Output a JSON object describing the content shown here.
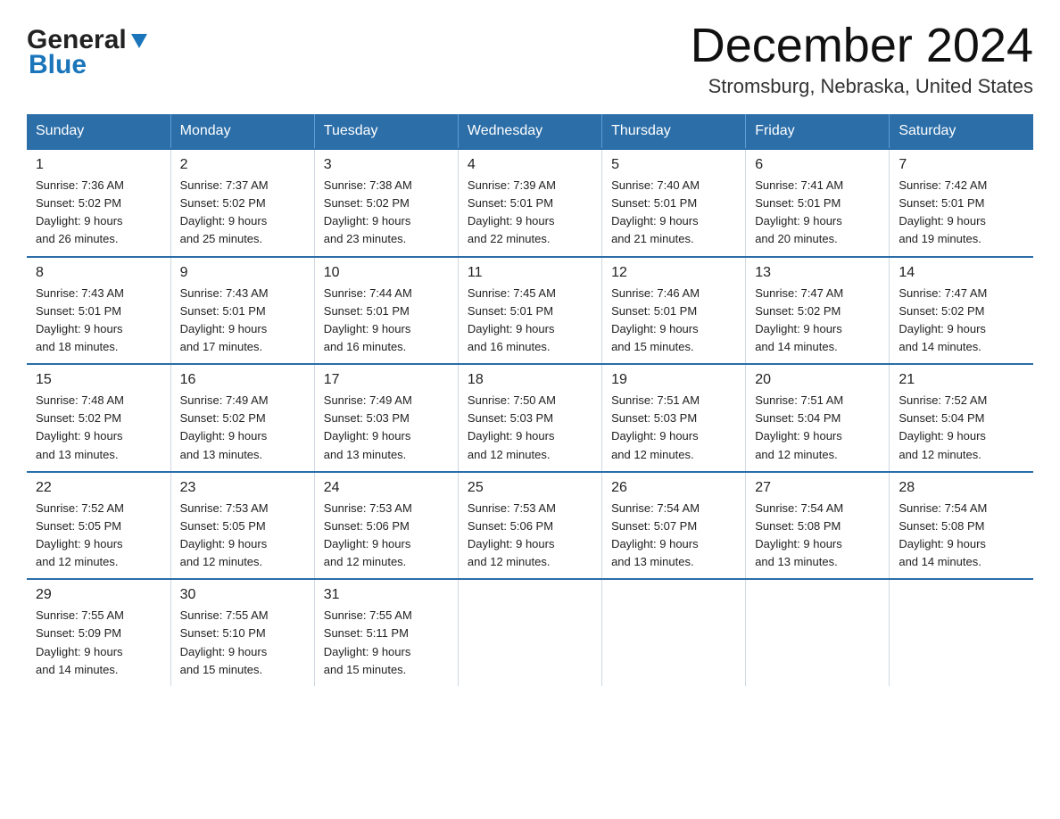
{
  "header": {
    "logo_general": "General",
    "logo_blue": "Blue",
    "month_title": "December 2024",
    "location": "Stromsburg, Nebraska, United States"
  },
  "calendar": {
    "days_of_week": [
      "Sunday",
      "Monday",
      "Tuesday",
      "Wednesday",
      "Thursday",
      "Friday",
      "Saturday"
    ],
    "weeks": [
      [
        {
          "date": "1",
          "sunrise": "7:36 AM",
          "sunset": "5:02 PM",
          "daylight": "9 hours and 26 minutes."
        },
        {
          "date": "2",
          "sunrise": "7:37 AM",
          "sunset": "5:02 PM",
          "daylight": "9 hours and 25 minutes."
        },
        {
          "date": "3",
          "sunrise": "7:38 AM",
          "sunset": "5:02 PM",
          "daylight": "9 hours and 23 minutes."
        },
        {
          "date": "4",
          "sunrise": "7:39 AM",
          "sunset": "5:01 PM",
          "daylight": "9 hours and 22 minutes."
        },
        {
          "date": "5",
          "sunrise": "7:40 AM",
          "sunset": "5:01 PM",
          "daylight": "9 hours and 21 minutes."
        },
        {
          "date": "6",
          "sunrise": "7:41 AM",
          "sunset": "5:01 PM",
          "daylight": "9 hours and 20 minutes."
        },
        {
          "date": "7",
          "sunrise": "7:42 AM",
          "sunset": "5:01 PM",
          "daylight": "9 hours and 19 minutes."
        }
      ],
      [
        {
          "date": "8",
          "sunrise": "7:43 AM",
          "sunset": "5:01 PM",
          "daylight": "9 hours and 18 minutes."
        },
        {
          "date": "9",
          "sunrise": "7:43 AM",
          "sunset": "5:01 PM",
          "daylight": "9 hours and 17 minutes."
        },
        {
          "date": "10",
          "sunrise": "7:44 AM",
          "sunset": "5:01 PM",
          "daylight": "9 hours and 16 minutes."
        },
        {
          "date": "11",
          "sunrise": "7:45 AM",
          "sunset": "5:01 PM",
          "daylight": "9 hours and 16 minutes."
        },
        {
          "date": "12",
          "sunrise": "7:46 AM",
          "sunset": "5:01 PM",
          "daylight": "9 hours and 15 minutes."
        },
        {
          "date": "13",
          "sunrise": "7:47 AM",
          "sunset": "5:02 PM",
          "daylight": "9 hours and 14 minutes."
        },
        {
          "date": "14",
          "sunrise": "7:47 AM",
          "sunset": "5:02 PM",
          "daylight": "9 hours and 14 minutes."
        }
      ],
      [
        {
          "date": "15",
          "sunrise": "7:48 AM",
          "sunset": "5:02 PM",
          "daylight": "9 hours and 13 minutes."
        },
        {
          "date": "16",
          "sunrise": "7:49 AM",
          "sunset": "5:02 PM",
          "daylight": "9 hours and 13 minutes."
        },
        {
          "date": "17",
          "sunrise": "7:49 AM",
          "sunset": "5:03 PM",
          "daylight": "9 hours and 13 minutes."
        },
        {
          "date": "18",
          "sunrise": "7:50 AM",
          "sunset": "5:03 PM",
          "daylight": "9 hours and 12 minutes."
        },
        {
          "date": "19",
          "sunrise": "7:51 AM",
          "sunset": "5:03 PM",
          "daylight": "9 hours and 12 minutes."
        },
        {
          "date": "20",
          "sunrise": "7:51 AM",
          "sunset": "5:04 PM",
          "daylight": "9 hours and 12 minutes."
        },
        {
          "date": "21",
          "sunrise": "7:52 AM",
          "sunset": "5:04 PM",
          "daylight": "9 hours and 12 minutes."
        }
      ],
      [
        {
          "date": "22",
          "sunrise": "7:52 AM",
          "sunset": "5:05 PM",
          "daylight": "9 hours and 12 minutes."
        },
        {
          "date": "23",
          "sunrise": "7:53 AM",
          "sunset": "5:05 PM",
          "daylight": "9 hours and 12 minutes."
        },
        {
          "date": "24",
          "sunrise": "7:53 AM",
          "sunset": "5:06 PM",
          "daylight": "9 hours and 12 minutes."
        },
        {
          "date": "25",
          "sunrise": "7:53 AM",
          "sunset": "5:06 PM",
          "daylight": "9 hours and 12 minutes."
        },
        {
          "date": "26",
          "sunrise": "7:54 AM",
          "sunset": "5:07 PM",
          "daylight": "9 hours and 13 minutes."
        },
        {
          "date": "27",
          "sunrise": "7:54 AM",
          "sunset": "5:08 PM",
          "daylight": "9 hours and 13 minutes."
        },
        {
          "date": "28",
          "sunrise": "7:54 AM",
          "sunset": "5:08 PM",
          "daylight": "9 hours and 14 minutes."
        }
      ],
      [
        {
          "date": "29",
          "sunrise": "7:55 AM",
          "sunset": "5:09 PM",
          "daylight": "9 hours and 14 minutes."
        },
        {
          "date": "30",
          "sunrise": "7:55 AM",
          "sunset": "5:10 PM",
          "daylight": "9 hours and 15 minutes."
        },
        {
          "date": "31",
          "sunrise": "7:55 AM",
          "sunset": "5:11 PM",
          "daylight": "9 hours and 15 minutes."
        },
        null,
        null,
        null,
        null
      ]
    ]
  }
}
